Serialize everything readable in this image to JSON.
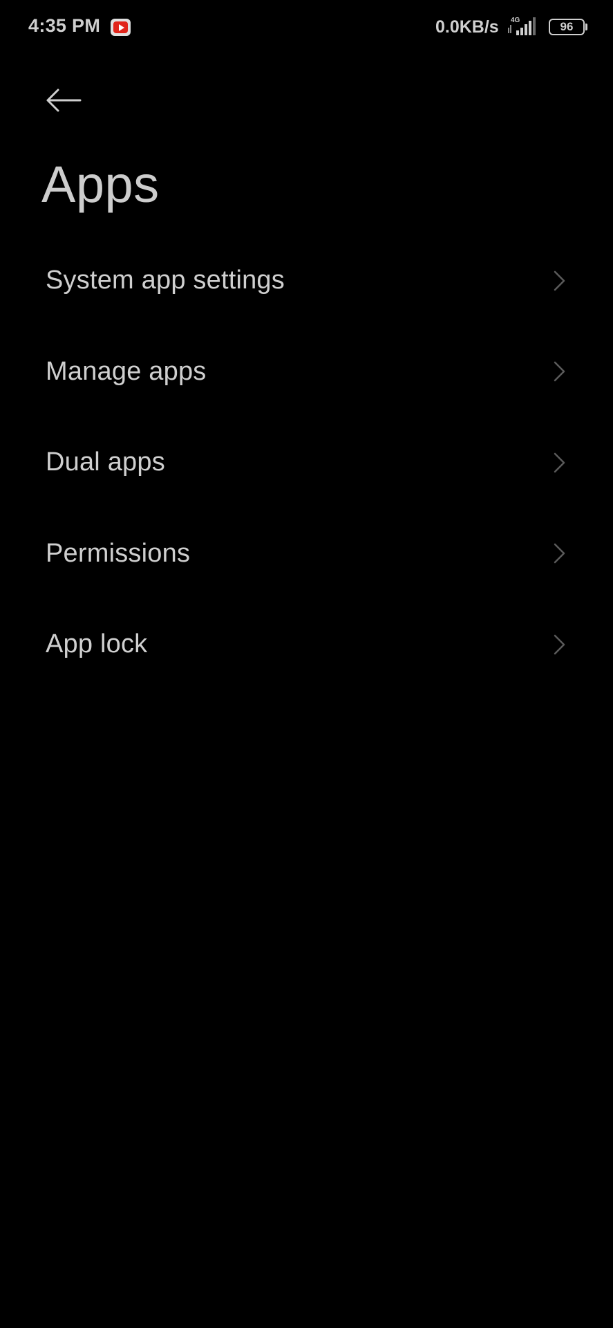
{
  "status_bar": {
    "time": "4:35 PM",
    "notification_icon": "youtube-icon",
    "net_speed": "0.0KB/s",
    "network_type": "4G",
    "battery_level": "96"
  },
  "header": {
    "back_icon": "back-arrow-icon",
    "title": "Apps"
  },
  "menu": {
    "items": [
      {
        "label": "System app settings",
        "icon": "chevron-right-icon"
      },
      {
        "label": "Manage apps",
        "icon": "chevron-right-icon"
      },
      {
        "label": "Dual apps",
        "icon": "chevron-right-icon"
      },
      {
        "label": "Permissions",
        "icon": "chevron-right-icon"
      },
      {
        "label": "App lock",
        "icon": "chevron-right-icon"
      }
    ]
  },
  "colors": {
    "background": "#000000",
    "text": "#cfcfcf",
    "chevron": "#5a5a5a"
  }
}
